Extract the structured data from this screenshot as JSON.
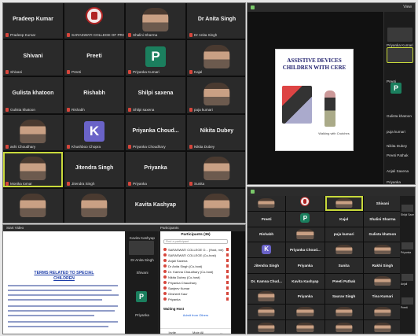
{
  "panel_a": {
    "tiles": [
      {
        "name": "Pradeep Kumar",
        "caption": "Pradeep Kumar",
        "kind": "name"
      },
      {
        "name": "",
        "caption": "SARASWATI COLLEGE OF PROFE...",
        "kind": "logo"
      },
      {
        "name": "",
        "caption": "Shalini Sharma",
        "kind": "video"
      },
      {
        "name": "Dr Anita Singh",
        "caption": "Dr Anita Singh",
        "kind": "name"
      },
      {
        "name": "Shivani",
        "caption": "Shivani",
        "kind": "name"
      },
      {
        "name": "Preeti",
        "caption": "Preeti",
        "kind": "name"
      },
      {
        "name": "P",
        "caption": "Priyanka Kumari",
        "kind": "avatar",
        "color": "#1b7f5e"
      },
      {
        "name": "",
        "caption": "Kajal",
        "kind": "video"
      },
      {
        "name": "Gulista khatoon",
        "caption": "Gulista khatoon",
        "kind": "name"
      },
      {
        "name": "Rishabh",
        "caption": "Rishabh",
        "kind": "name"
      },
      {
        "name": "Shilpi saxena",
        "caption": "Shilpi saxena",
        "kind": "name"
      },
      {
        "name": "",
        "caption": "puja kumari",
        "kind": "video"
      },
      {
        "name": "",
        "caption": "ashi Choudhary",
        "kind": "video"
      },
      {
        "name": "K",
        "caption": "Khushboo Chopra",
        "kind": "avatar",
        "color": "#6a63c8"
      },
      {
        "name": "Priyanka  Choud...",
        "caption": "Priyanka Choudhary",
        "kind": "name"
      },
      {
        "name": "Nikita Dubey",
        "caption": "Nikita Dubey",
        "kind": "name"
      },
      {
        "name": "",
        "caption": "Monika tomar",
        "kind": "video",
        "highlight": true
      },
      {
        "name": "Jitendra Singh",
        "caption": "Jitendra Singh",
        "kind": "name"
      },
      {
        "name": "Priyanka",
        "caption": "Priyanka",
        "kind": "name"
      },
      {
        "name": "",
        "caption": "Sunita",
        "kind": "video"
      },
      {
        "name": "",
        "caption": "",
        "kind": "video"
      },
      {
        "name": "",
        "caption": "",
        "kind": "video"
      },
      {
        "name": "Kavita Kashyap",
        "caption": "",
        "kind": "name"
      },
      {
        "name": "",
        "caption": "",
        "kind": "video"
      }
    ]
  },
  "panel_b": {
    "slide": {
      "title_line1": "ASSISTIVE DEVICES",
      "title_line2": "CHILDREN WITH CERE",
      "caption": "Walking with Crutches"
    },
    "side_labels": [
      "Priyanka Kumari",
      "Preeti",
      "P",
      "Gulista khatoon",
      "puja kumari",
      "Nikita Dubey",
      "Preeti Pathak",
      "Anjali Saxena",
      "Priyanka"
    ],
    "topbar_text": "View"
  },
  "panel_c": {
    "doc_title_line1": "TERMS RELATED TO SPECIAL",
    "doc_title_line2": "CHILDREN",
    "docbar_left": "Start Video",
    "docbar_mid": "Participants",
    "strip": [
      "Kavita Kashyap",
      "Dr Anita Singh",
      "Shivani",
      "P",
      "Priyanka"
    ],
    "participants": {
      "header": "Participants (36)",
      "search": "Find a participant",
      "rows": [
        "SARASWATI COLLEGE O... (Host, me)",
        "SARASWATI COLLEGE (Co-host)",
        "Anjali Saxena",
        "Dr Anita Singh (Co-host)",
        "Dr. Kamna Chaudhary (Co-host)",
        "Nikita Dubey (Co-host)",
        "Priyanka Chaudhary",
        "Sanjeev Kumar",
        "Ghsheet Kaur",
        "Priyanka"
      ],
      "waiting_header": "Waiting Host",
      "waiting_link": "Admit from Others",
      "footer": [
        "Invite",
        "Mute All",
        "..."
      ]
    }
  },
  "panel_d": {
    "tiles": [
      {
        "name": "",
        "caption": "",
        "kind": "video"
      },
      {
        "name": "",
        "caption": "",
        "kind": "logo"
      },
      {
        "name": "",
        "caption": "",
        "kind": "video",
        "highlight": true
      },
      {
        "name": "Shivani",
        "caption": "",
        "kind": "name"
      },
      {
        "name": "Preeti",
        "caption": "",
        "kind": "name"
      },
      {
        "name": "P",
        "caption": "",
        "kind": "avatar",
        "color": "#1b7f5e"
      },
      {
        "name": "Kajal",
        "caption": "",
        "kind": "name"
      },
      {
        "name": "Shalini Sharma",
        "caption": "",
        "kind": "name"
      },
      {
        "name": "Rishabh",
        "caption": "",
        "kind": "name"
      },
      {
        "name": "",
        "caption": "",
        "kind": "video"
      },
      {
        "name": "puja kumari",
        "caption": "",
        "kind": "name"
      },
      {
        "name": "Gulista khatoon",
        "caption": "",
        "kind": "name"
      },
      {
        "name": "K",
        "caption": "",
        "kind": "avatar",
        "color": "#6a63c8"
      },
      {
        "name": "Priyanka  Choud...",
        "caption": "",
        "kind": "name"
      },
      {
        "name": "",
        "caption": "",
        "kind": "video"
      },
      {
        "name": "",
        "caption": "",
        "kind": "video"
      },
      {
        "name": "Jitendra Singh",
        "caption": "",
        "kind": "name"
      },
      {
        "name": "Priyanka",
        "caption": "",
        "kind": "name"
      },
      {
        "name": "Sunita",
        "caption": "",
        "kind": "name"
      },
      {
        "name": "Rakhi Singh",
        "caption": "",
        "kind": "name"
      },
      {
        "name": "Dr. Kamna Chud...",
        "caption": "",
        "kind": "name"
      },
      {
        "name": "Kavita Kashyap",
        "caption": "",
        "kind": "name"
      },
      {
        "name": "Preeti Pathak",
        "caption": "",
        "kind": "name"
      },
      {
        "name": "",
        "caption": "",
        "kind": "video"
      },
      {
        "name": "",
        "caption": "",
        "kind": "video"
      },
      {
        "name": "Priyanka",
        "caption": "",
        "kind": "name"
      },
      {
        "name": "Saurav Singh",
        "caption": "",
        "kind": "name"
      },
      {
        "name": "Tina Kumari",
        "caption": "",
        "kind": "name"
      },
      {
        "name": "",
        "caption": "",
        "kind": "video"
      },
      {
        "name": "",
        "caption": "",
        "kind": "video"
      },
      {
        "name": "",
        "caption": "",
        "kind": "video"
      },
      {
        "name": "",
        "caption": "",
        "kind": "video"
      },
      {
        "name": "",
        "caption": "",
        "kind": "video"
      },
      {
        "name": "",
        "caption": "",
        "kind": "video"
      },
      {
        "name": "",
        "caption": "",
        "kind": "video"
      },
      {
        "name": "",
        "caption": "",
        "kind": "video"
      }
    ],
    "right_labels": [
      "Shilpi Saxena",
      "Priyanka",
      "Anjali",
      "Preeti"
    ]
  }
}
